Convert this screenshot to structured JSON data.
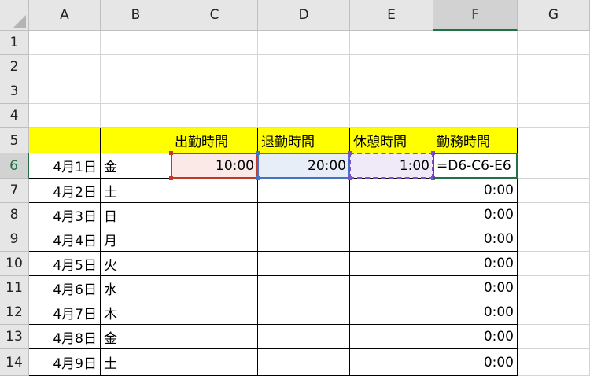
{
  "columns": [
    "A",
    "B",
    "C",
    "D",
    "E",
    "F",
    "G"
  ],
  "active_column": "F",
  "rows": [
    "1",
    "2",
    "3",
    "4",
    "5",
    "6",
    "7",
    "8",
    "9",
    "10",
    "11",
    "12",
    "13",
    "14"
  ],
  "active_row": "6",
  "headers": {
    "C5": "出勤時間",
    "D5": "退勤時間",
    "E5": "休憩時間",
    "F5": "勤務時間"
  },
  "data_rows": [
    {
      "row": "6",
      "date": "4月1日",
      "weekday": "金",
      "start": "10:00",
      "end": "20:00",
      "break": "1:00",
      "work": "=D6-C6-E6"
    },
    {
      "row": "7",
      "date": "4月2日",
      "weekday": "土",
      "start": "",
      "end": "",
      "break": "",
      "work": "0:00"
    },
    {
      "row": "8",
      "date": "4月3日",
      "weekday": "日",
      "start": "",
      "end": "",
      "break": "",
      "work": "0:00"
    },
    {
      "row": "9",
      "date": "4月4日",
      "weekday": "月",
      "start": "",
      "end": "",
      "break": "",
      "work": "0:00"
    },
    {
      "row": "10",
      "date": "4月5日",
      "weekday": "火",
      "start": "",
      "end": "",
      "break": "",
      "work": "0:00"
    },
    {
      "row": "11",
      "date": "4月6日",
      "weekday": "水",
      "start": "",
      "end": "",
      "break": "",
      "work": "0:00"
    },
    {
      "row": "12",
      "date": "4月7日",
      "weekday": "木",
      "start": "",
      "end": "",
      "break": "",
      "work": "0:00"
    },
    {
      "row": "13",
      "date": "4月8日",
      "weekday": "金",
      "start": "",
      "end": "",
      "break": "",
      "work": "0:00"
    },
    {
      "row": "14",
      "date": "4月9日",
      "weekday": "土",
      "start": "",
      "end": "",
      "break": "",
      "work": "0:00"
    }
  ],
  "colors": {
    "header_fill": "#ffff00",
    "ref_start_fill": "#fbe9e7",
    "ref_end_fill": "#e8eef8",
    "ref_break_fill": "#efe9f8",
    "ref_start_border": "#c0392b",
    "ref_end_border": "#4472c4",
    "ref_break_border": "#7f4fc9",
    "active_border": "#217346"
  }
}
